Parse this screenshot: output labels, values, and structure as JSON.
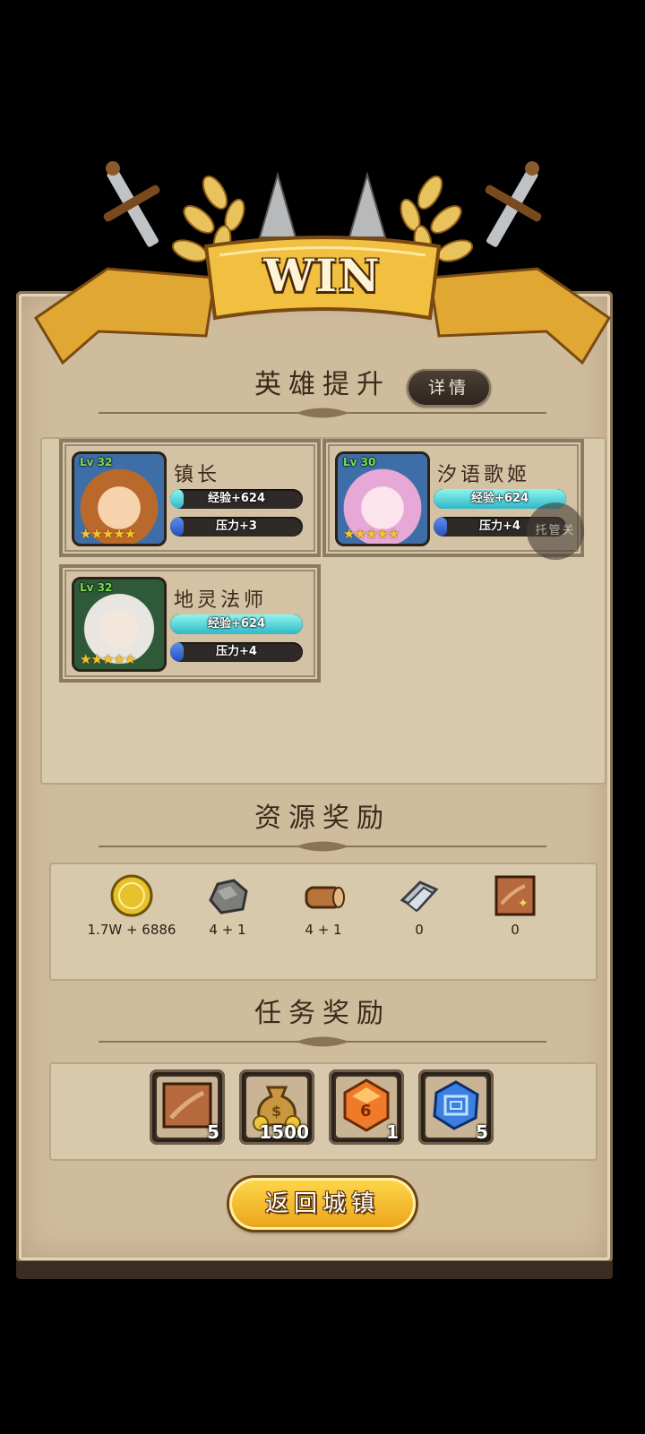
{
  "banner": {
    "title": "WIN"
  },
  "hero_section": {
    "title": "英雄提升",
    "details_label": "详情",
    "heroes": [
      {
        "name": "镇长",
        "level": "Lv 32",
        "stars": 5,
        "exp_label": "经验+624",
        "exp_fill": 0.1,
        "pressure_label": "压力+3",
        "pressure_fill": 0.1
      },
      {
        "name": "汐语歌姬",
        "level": "Lv 30",
        "stars": 5,
        "exp_label": "经验+624",
        "exp_fill": 1.0,
        "pressure_label": "压力+4",
        "pressure_fill": 0.1
      },
      {
        "name": "地灵法师",
        "level": "Lv 32",
        "stars": 5,
        "exp_label": "经验+624",
        "exp_fill": 1.0,
        "pressure_label": "压力+4",
        "pressure_fill": 0.1
      }
    ]
  },
  "auto_button": {
    "label": "托管关"
  },
  "resource_section": {
    "title": "资源奖励",
    "items": [
      {
        "icon": "gold-coin-icon",
        "value": "1.7W + 6886"
      },
      {
        "icon": "stone-ore-icon",
        "value": "4 + 1"
      },
      {
        "icon": "wood-log-icon",
        "value": "4 + 1"
      },
      {
        "icon": "iron-ingot-icon",
        "value": "0"
      },
      {
        "icon": "leather-scroll-icon",
        "value": "0"
      }
    ]
  },
  "task_section": {
    "title": "任务奖励",
    "items": [
      {
        "icon": "leather-scroll-icon",
        "qty": "5"
      },
      {
        "icon": "money-bag-icon",
        "qty": "1500"
      },
      {
        "icon": "orange-gem-icon",
        "qty": "1"
      },
      {
        "icon": "blue-crystal-icon",
        "qty": "5"
      }
    ]
  },
  "return_button": {
    "label": "返回城镇"
  },
  "colors": {
    "panel": "#cfbc9d",
    "gold": "#f2c040",
    "exp_bar": "#4fd8dc",
    "pressure_bar": "#3a63d0",
    "dark_text": "#3c2a1a"
  }
}
